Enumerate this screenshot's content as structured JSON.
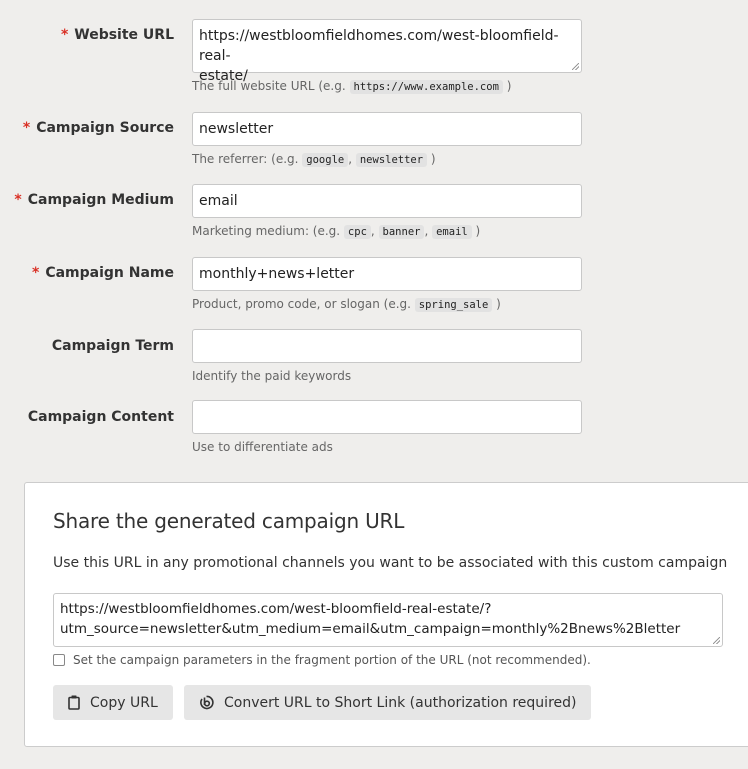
{
  "form": {
    "required_marker": "*",
    "fields": [
      {
        "label": "Website URL",
        "required": true,
        "value_line1": "https://westbloomfieldhomes.com/west-bloomfield-real-",
        "value_line2": "estate/",
        "help_prefix": "The full website URL (e.g. ",
        "help_codes": [
          "https://www.example.com"
        ],
        "help_suffix": " )"
      },
      {
        "label": "Campaign Source",
        "required": true,
        "value": "newsletter",
        "help_prefix": "The referrer: (e.g. ",
        "help_codes": [
          "google",
          "newsletter"
        ],
        "help_suffix": " )"
      },
      {
        "label": "Campaign Medium",
        "required": true,
        "value": "email",
        "help_prefix": "Marketing medium: (e.g. ",
        "help_codes": [
          "cpc",
          "banner",
          "email"
        ],
        "help_suffix": " )"
      },
      {
        "label": "Campaign Name",
        "required": true,
        "value": "monthly+news+letter",
        "help_prefix": "Product, promo code, or slogan (e.g. ",
        "help_codes": [
          "spring_sale"
        ],
        "help_suffix": " )"
      },
      {
        "label": "Campaign Term",
        "required": false,
        "value": "",
        "help_prefix": "Identify the paid keywords"
      },
      {
        "label": "Campaign Content",
        "required": false,
        "value": "",
        "help_prefix": "Use to differentiate ads"
      }
    ],
    "separator": ", "
  },
  "share": {
    "title": "Share the generated campaign URL",
    "description": "Use this URL in any promotional channels you want to be associated with this custom campaign",
    "url_line1": "https://westbloomfieldhomes.com/west-bloomfield-real-estate/?",
    "url_line2": "utm_source=newsletter&utm_medium=email&utm_campaign=monthly%2Bnews%2Bletter",
    "fragment_checkbox_label": "Set the campaign parameters in the fragment portion of the URL (not recommended).",
    "fragment_checked": false,
    "copy_button": {
      "label": "Copy URL",
      "icon": "clipboard-icon"
    },
    "shortlink_button": {
      "label": "Convert URL to Short Link (authorization required)",
      "icon": "bitly-icon"
    }
  }
}
